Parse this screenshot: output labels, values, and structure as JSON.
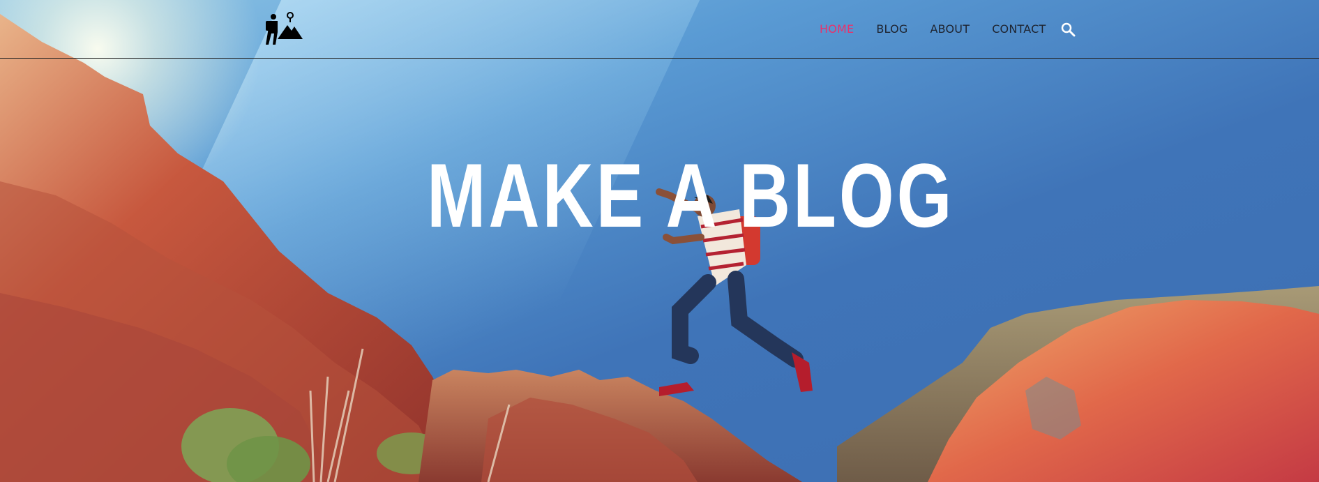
{
  "nav": {
    "logo_icon": "hiker-mountain-logo-icon",
    "items": [
      {
        "label": "HOME",
        "active": true
      },
      {
        "label": "BLOG",
        "active": false
      },
      {
        "label": "ABOUT",
        "active": false
      },
      {
        "label": "CONTACT",
        "active": false
      }
    ],
    "search_icon": "search-icon",
    "active_color": "#e8326b",
    "text_color": "#1e2430"
  },
  "hero": {
    "headline": "MAKE A BLOG",
    "background": "hiker jumping between red rock cliffs under blue sky"
  }
}
